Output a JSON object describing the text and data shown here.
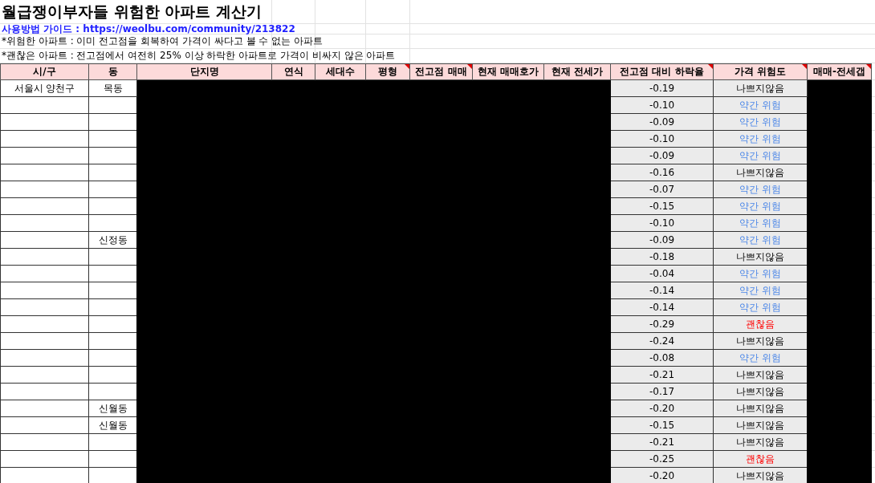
{
  "title": "월급쟁이부자들 위험한 아파트 계산기",
  "guide": {
    "label": "사용방법 가이드 : ",
    "link": "https://weolbu.com/community/213822"
  },
  "notes": [
    "*위험한 아파트 : 이미 전고점을 회복하여 가격이 싸다고 볼 수 없는 아파트",
    "*괜찮은 아파트 : 전고점에서 여전히 25% 이상 하락한 아파트로 가격이 비싸지 않은 아파트"
  ],
  "table": {
    "columns": [
      {
        "label": "시/구",
        "note": false
      },
      {
        "label": "동",
        "note": false
      },
      {
        "label": "단지명",
        "note": false
      },
      {
        "label": "연식",
        "note": false
      },
      {
        "label": "세대수",
        "note": false
      },
      {
        "label": "평형",
        "note": true
      },
      {
        "label": "전고점 매매",
        "note": true
      },
      {
        "label": "현재 매매호가",
        "note": false
      },
      {
        "label": "현재 전세가",
        "note": false
      },
      {
        "label": "전고점 대비 하락율",
        "note": true
      },
      {
        "label": "가격 위험도",
        "note": true
      },
      {
        "label": "매매-전세갭",
        "note": true
      }
    ],
    "rows": [
      {
        "city": "서울시 양천구",
        "dong": "목동",
        "drop": "-0.19",
        "risk": "나쁘지않음",
        "kind": "fine"
      },
      {
        "drop": "-0.10",
        "risk": "약간 위험",
        "kind": "caution"
      },
      {
        "drop": "-0.09",
        "risk": "약간 위험",
        "kind": "caution"
      },
      {
        "drop": "-0.10",
        "risk": "약간 위험",
        "kind": "caution"
      },
      {
        "drop": "-0.09",
        "risk": "약간 위험",
        "kind": "caution"
      },
      {
        "drop": "-0.16",
        "risk": "나쁘지않음",
        "kind": "fine"
      },
      {
        "drop": "-0.07",
        "risk": "약간 위험",
        "kind": "caution"
      },
      {
        "drop": "-0.15",
        "risk": "약간 위험",
        "kind": "caution"
      },
      {
        "drop": "-0.10",
        "risk": "약간 위험",
        "kind": "caution"
      },
      {
        "dong": "신정동",
        "drop": "-0.09",
        "risk": "약간 위험",
        "kind": "caution"
      },
      {
        "drop": "-0.18",
        "risk": "나쁘지않음",
        "kind": "fine"
      },
      {
        "drop": "-0.04",
        "risk": "약간 위험",
        "kind": "caution"
      },
      {
        "drop": "-0.14",
        "risk": "약간 위험",
        "kind": "caution"
      },
      {
        "drop": "-0.14",
        "risk": "약간 위험",
        "kind": "caution"
      },
      {
        "drop": "-0.29",
        "risk": "괜찮음",
        "kind": "good"
      },
      {
        "drop": "-0.24",
        "risk": "나쁘지않음",
        "kind": "fine"
      },
      {
        "drop": "-0.08",
        "risk": "약간 위험",
        "kind": "caution"
      },
      {
        "drop": "-0.21",
        "risk": "나쁘지않음",
        "kind": "fine"
      },
      {
        "drop": "-0.17",
        "risk": "나쁘지않음",
        "kind": "fine"
      },
      {
        "dong": "신월동",
        "drop": "-0.20",
        "risk": "나쁘지않음",
        "kind": "fine"
      },
      {
        "dong": "신월동",
        "drop": "-0.15",
        "risk": "나쁘지않음",
        "kind": "fine"
      },
      {
        "drop": "-0.21",
        "risk": "나쁘지않음",
        "kind": "fine"
      },
      {
        "drop": "-0.25",
        "risk": "괜찮음",
        "kind": "good"
      },
      {
        "drop": "-0.20",
        "risk": "나쁘지않음",
        "kind": "fine"
      }
    ]
  }
}
